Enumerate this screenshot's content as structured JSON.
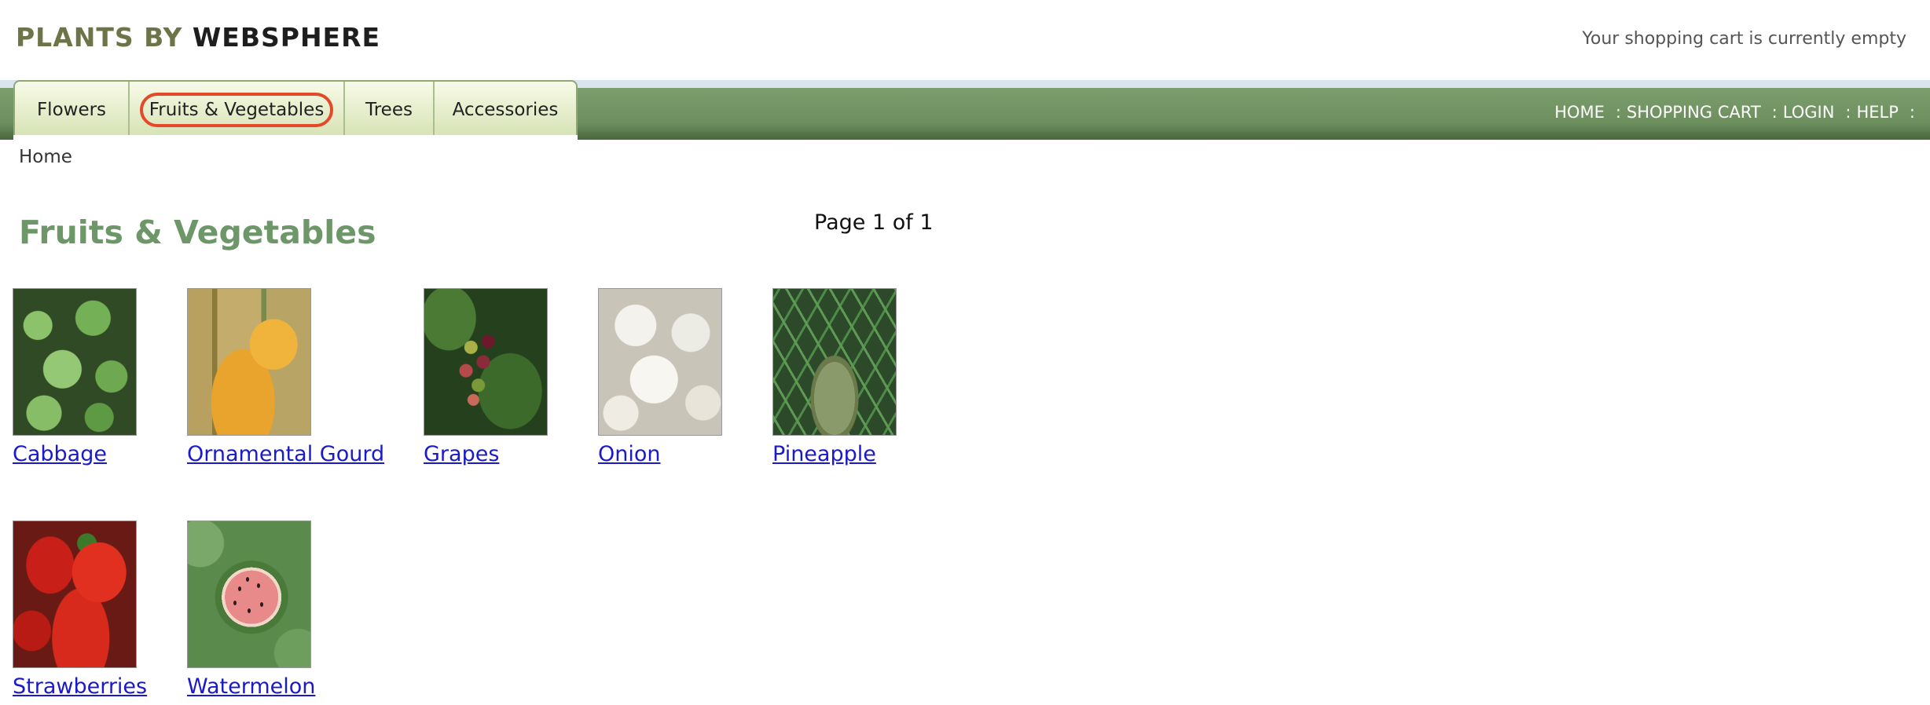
{
  "header": {
    "logo_part1": "PLANTS BY",
    "logo_part2": "WEBSPHERE",
    "cart_status": "Your shopping cart is currently empty"
  },
  "nav": {
    "tabs": [
      {
        "label": "Flowers"
      },
      {
        "label": "Fruits & Vegetables",
        "active": true
      },
      {
        "label": "Trees"
      },
      {
        "label": "Accessories"
      }
    ],
    "links": [
      {
        "label": "HOME"
      },
      {
        "label": "SHOPPING CART"
      },
      {
        "label": "LOGIN"
      },
      {
        "label": "HELP"
      }
    ],
    "separator": ":"
  },
  "breadcrumb": "Home",
  "page_title": "Fruits & Vegetables",
  "page_indicator": "Page 1 of 1",
  "products": [
    {
      "name": "Cabbage",
      "image": "cabbage-photo"
    },
    {
      "name": "Ornamental Gourd",
      "image": "gourd-photo"
    },
    {
      "name": "Grapes",
      "image": "grapes-photo"
    },
    {
      "name": "Onion",
      "image": "onion-photo"
    },
    {
      "name": "Pineapple",
      "image": "pineapple-photo"
    },
    {
      "name": "Strawberries",
      "image": "strawberries-photo"
    },
    {
      "name": "Watermelon",
      "image": "watermelon-photo"
    }
  ],
  "colors": {
    "nav_green": "#6d8f5e",
    "title_green": "#6d9768",
    "link_blue": "#1a1acc",
    "active_tab_outline": "#e24a2a"
  }
}
